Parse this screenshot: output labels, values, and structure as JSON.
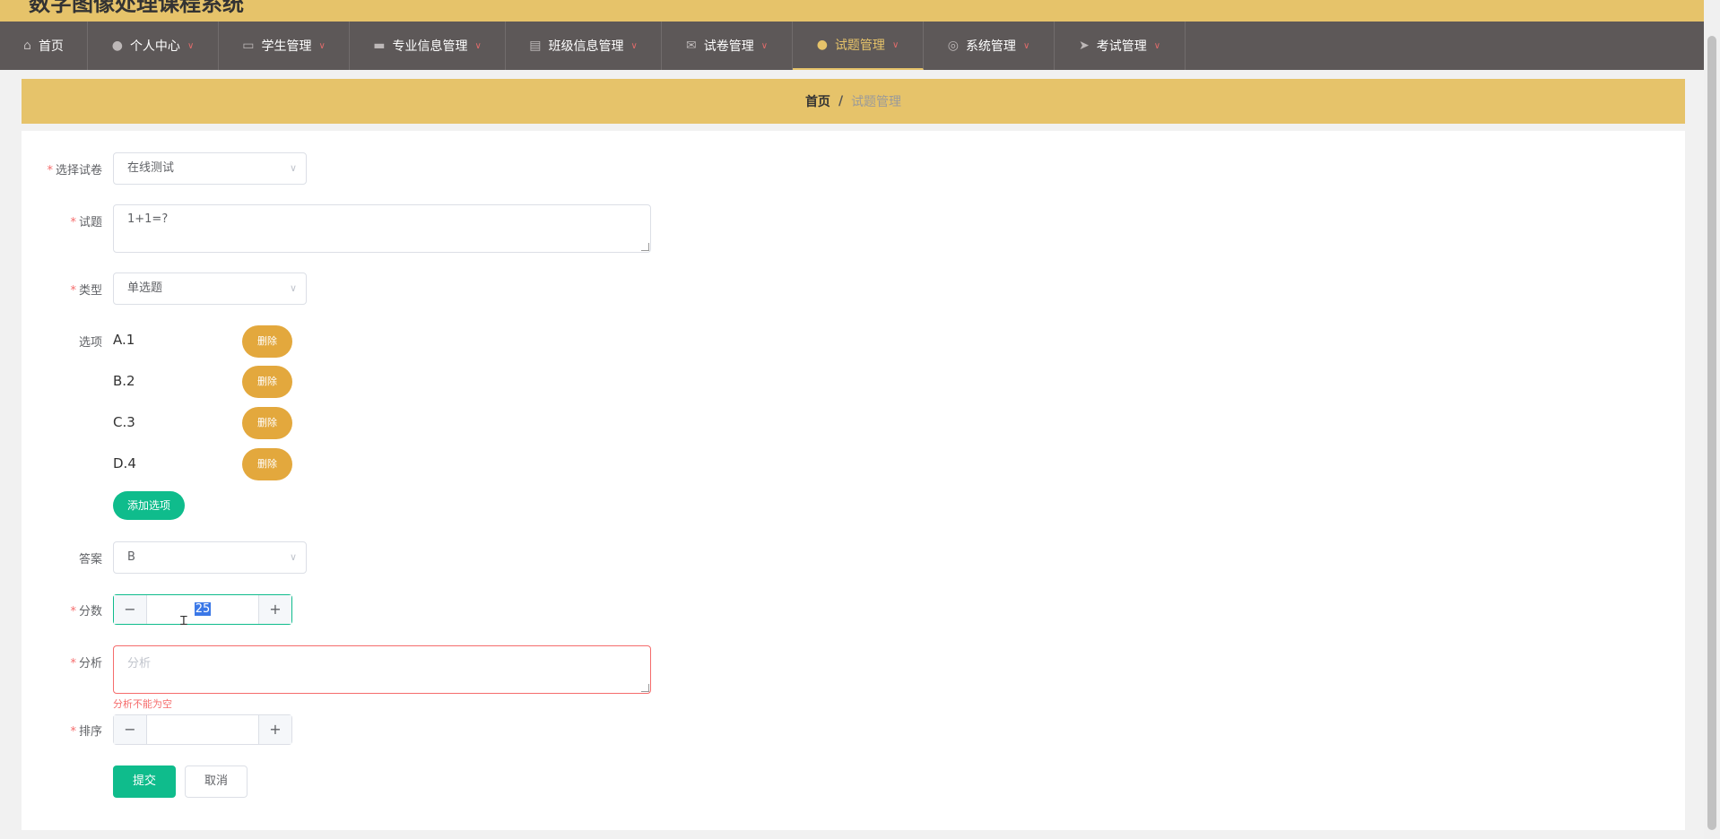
{
  "app": {
    "title": "数字图像处理课程系统"
  },
  "nav": {
    "items": [
      {
        "label": "首页",
        "icon": "home-icon",
        "has_dropdown": false
      },
      {
        "label": "个人中心",
        "icon": "user-icon",
        "has_dropdown": true
      },
      {
        "label": "学生管理",
        "icon": "monitor-icon",
        "has_dropdown": true
      },
      {
        "label": "专业信息管理",
        "icon": "chat-icon",
        "has_dropdown": true
      },
      {
        "label": "班级信息管理",
        "icon": "clipboard-icon",
        "has_dropdown": true
      },
      {
        "label": "试卷管理",
        "icon": "mail-icon",
        "has_dropdown": true
      },
      {
        "label": "试题管理",
        "icon": "user-icon",
        "has_dropdown": true,
        "active": true
      },
      {
        "label": "系统管理",
        "icon": "compass-icon",
        "has_dropdown": true
      },
      {
        "label": "考试管理",
        "icon": "send-icon",
        "has_dropdown": true
      }
    ]
  },
  "breadcrumb": {
    "home": "首页",
    "separator": "/",
    "current": "试题管理"
  },
  "form": {
    "paper": {
      "label": "选择试卷",
      "required": true,
      "value": "在线测试"
    },
    "question": {
      "label": "试题",
      "required": true,
      "value": "1+1=?"
    },
    "type": {
      "label": "类型",
      "required": true,
      "value": "单选题"
    },
    "options": {
      "label": "选项",
      "items": [
        "A.1",
        "B.2",
        "C.3",
        "D.4"
      ],
      "delete_label": "删除",
      "add_label": "添加选项"
    },
    "answer": {
      "label": "答案",
      "required": false,
      "value": "B"
    },
    "score": {
      "label": "分数",
      "required": true,
      "value": "25",
      "minus": "−",
      "plus": "+"
    },
    "analysis": {
      "label": "分析",
      "required": true,
      "placeholder": "分析",
      "error": "分析不能为空"
    },
    "order": {
      "label": "排序",
      "required": true,
      "value": "",
      "minus": "−",
      "plus": "+"
    },
    "submit_label": "提交",
    "cancel_label": "取消"
  },
  "colors": {
    "accent": "#e6c36a",
    "nav_bg": "#5d5858",
    "primary": "#0fbc8c",
    "delete": "#e3a83d",
    "error": "#f56c6c"
  }
}
